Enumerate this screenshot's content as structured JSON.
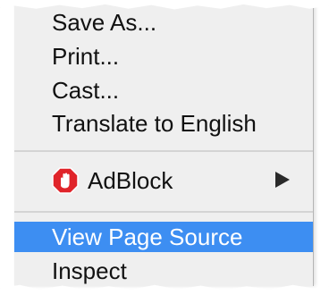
{
  "menu": {
    "items": [
      {
        "label": "Save As..."
      },
      {
        "label": "Print..."
      },
      {
        "label": "Cast..."
      },
      {
        "label": "Translate to English"
      }
    ],
    "adblock": {
      "label": "AdBlock",
      "icon": "adblock-hand-stop-icon",
      "icon_color": "#e0242a",
      "has_submenu": true
    },
    "view_source": {
      "label": "View Page Source",
      "highlighted": true
    },
    "inspect": {
      "label": "Inspect"
    }
  },
  "colors": {
    "menu_background": "#efefef",
    "highlight": "#3d8ef2",
    "highlight_text": "#ffffff",
    "text": "#111111"
  }
}
